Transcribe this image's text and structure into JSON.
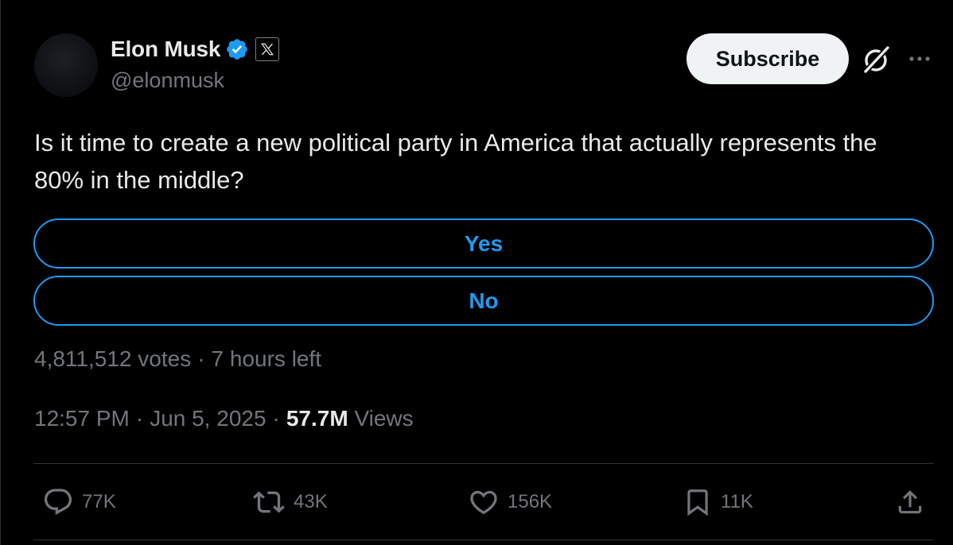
{
  "author": {
    "name": "Elon Musk",
    "handle": "@elonmusk"
  },
  "header_actions": {
    "subscribe_label": "Subscribe"
  },
  "tweet": {
    "text": "Is it time to create a new political party in America that actually represents the 80% in the middle?"
  },
  "poll": {
    "options": [
      {
        "label": "Yes"
      },
      {
        "label": "No"
      }
    ],
    "votes": "4,811,512 votes",
    "separator": "·",
    "time_left": "7 hours left"
  },
  "meta": {
    "time": "12:57 PM",
    "date": "Jun 5, 2025",
    "separator": "·",
    "views_count": "57.7M",
    "views_label": "Views"
  },
  "actions": {
    "replies": "77K",
    "reposts": "43K",
    "likes": "156K",
    "bookmarks": "11K"
  },
  "colors": {
    "accent": "#1d9bf0",
    "background": "#000000",
    "text_primary": "#e7e9ea",
    "text_secondary": "#71767b",
    "divider": "#2f3336"
  },
  "icons": [
    "verified-badge-icon",
    "x-affiliation-icon",
    "grok-icon",
    "more-icon",
    "reply-icon",
    "repost-icon",
    "like-icon",
    "bookmark-icon",
    "share-icon"
  ]
}
